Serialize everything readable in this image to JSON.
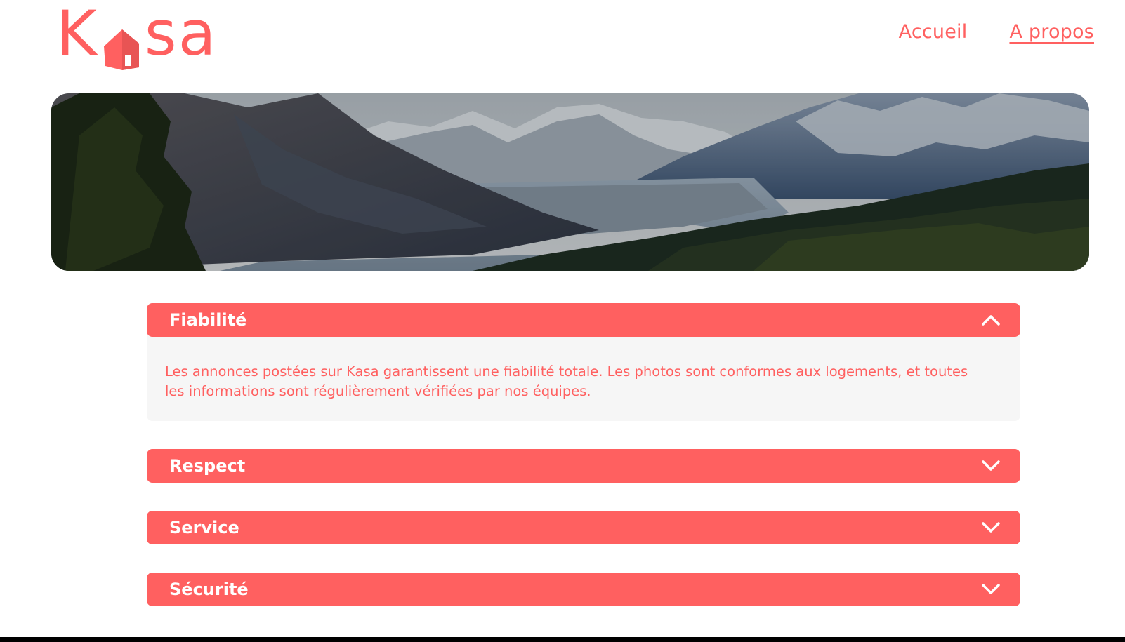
{
  "header": {
    "logo": {
      "k": "K",
      "rest": "sa",
      "icon": "house-icon"
    },
    "nav": [
      {
        "label": "Accueil",
        "active": false
      },
      {
        "label": "A propos",
        "active": true
      }
    ]
  },
  "banner": {
    "image": "mountain-valley-landscape"
  },
  "accordion": {
    "items": [
      {
        "title": "Fiabilité",
        "open": true,
        "content": "Les annonces postées sur Kasa garantissent une fiabilité totale. Les photos sont conformes aux logements, et toutes les informations sont régulièrement vérifiées par nos équipes.",
        "icon": "chevron-up-icon"
      },
      {
        "title": "Respect",
        "open": false,
        "icon": "chevron-down-icon"
      },
      {
        "title": "Service",
        "open": false,
        "icon": "chevron-down-icon"
      },
      {
        "title": "Sécurité",
        "open": false,
        "icon": "chevron-down-icon"
      }
    ]
  },
  "colors": {
    "accent": "#FF6060",
    "panel": "#F6F6F6"
  }
}
